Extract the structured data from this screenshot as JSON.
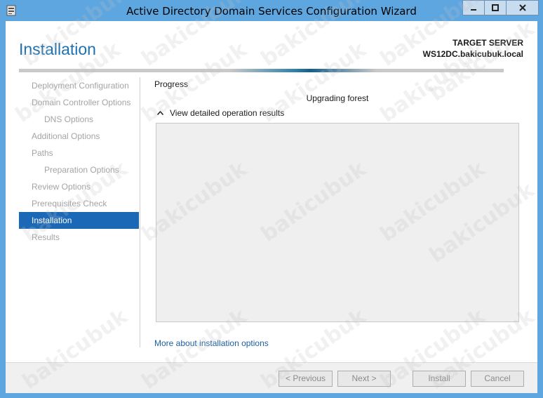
{
  "window": {
    "title": "Active Directory Domain Services Configuration Wizard",
    "controls": [
      "minimize",
      "maximize",
      "close"
    ]
  },
  "header": {
    "page_title": "Installation",
    "target_label": "TARGET SERVER",
    "target_server": "WS12DC.bakicubuk.local"
  },
  "sidebar": {
    "items": [
      {
        "label": "Deployment Configuration",
        "level": 0,
        "state": "disabled"
      },
      {
        "label": "Domain Controller Options",
        "level": 0,
        "state": "disabled"
      },
      {
        "label": "DNS Options",
        "level": 1,
        "state": "disabled"
      },
      {
        "label": "Additional Options",
        "level": 0,
        "state": "disabled"
      },
      {
        "label": "Paths",
        "level": 0,
        "state": "disabled"
      },
      {
        "label": "Preparation Options",
        "level": 1,
        "state": "disabled"
      },
      {
        "label": "Review Options",
        "level": 0,
        "state": "disabled"
      },
      {
        "label": "Prerequisites Check",
        "level": 0,
        "state": "disabled"
      },
      {
        "label": "Installation",
        "level": 0,
        "state": "active"
      },
      {
        "label": "Results",
        "level": 0,
        "state": "disabled"
      }
    ]
  },
  "main": {
    "section_label": "Progress",
    "status_text": "Upgrading forest",
    "expander_label": "View detailed operation results",
    "more_link": "More about installation options"
  },
  "footer": {
    "previous_label": "< Previous",
    "next_label": "Next >",
    "install_label": "Install",
    "cancel_label": "Cancel"
  },
  "watermark_text": "bakicubuk",
  "colors": {
    "titlebar": "#5ea6e0",
    "accent": "#1a68b6",
    "heading": "#1e72b0",
    "link": "#1e5fa0"
  }
}
